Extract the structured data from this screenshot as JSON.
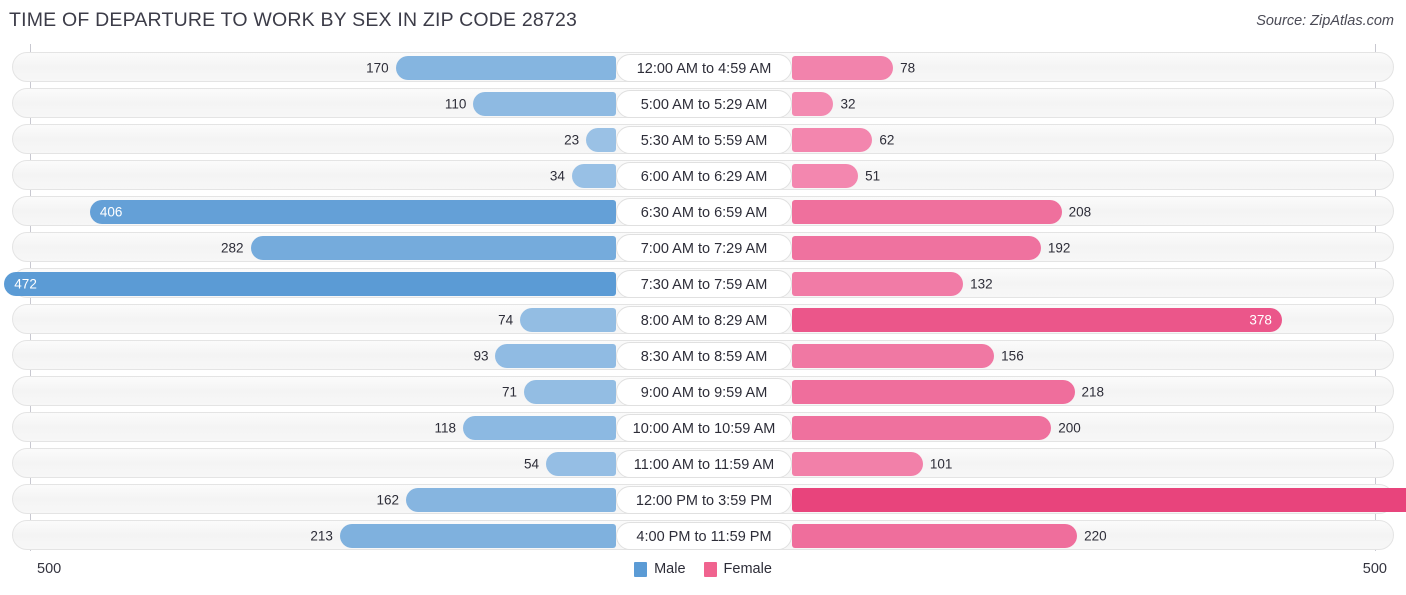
{
  "header": {
    "title": "TIME OF DEPARTURE TO WORK BY SEX IN ZIP CODE 28723",
    "source": "Source: ZipAtlas.com"
  },
  "axis": {
    "max_left_label": "500",
    "max_right_label": "500"
  },
  "legend": {
    "items": [
      {
        "label": "Male",
        "color": "#5b9bd5"
      },
      {
        "label": "Female",
        "color": "#f0638f"
      }
    ]
  },
  "colors": {
    "male_strong": "#5b9bd5",
    "male_light": "#9dc3e6",
    "female_strong": "#e8447c",
    "female_light": "#f48fb5",
    "track": "#f5f5f5",
    "axis": "#c8c8d0",
    "title": "#3c3c48"
  },
  "chart_data": {
    "type": "bar",
    "subtype": "diverging-bidirectional",
    "title": "TIME OF DEPARTURE TO WORK BY SEX IN ZIP CODE 28723",
    "xlabel": "",
    "ylabel": "",
    "xlim": [
      500,
      500
    ],
    "axis_max": 500,
    "grid": false,
    "legend_position": "bottom-center",
    "categories": [
      "12:00 AM to 4:59 AM",
      "5:00 AM to 5:29 AM",
      "5:30 AM to 5:59 AM",
      "6:00 AM to 6:29 AM",
      "6:30 AM to 6:59 AM",
      "7:00 AM to 7:29 AM",
      "7:30 AM to 7:59 AM",
      "8:00 AM to 8:29 AM",
      "8:30 AM to 8:59 AM",
      "9:00 AM to 9:59 AM",
      "10:00 AM to 10:59 AM",
      "11:00 AM to 11:59 AM",
      "12:00 PM to 3:59 PM",
      "4:00 PM to 11:59 PM"
    ],
    "series": [
      {
        "name": "Male",
        "direction": "left",
        "values": [
          170,
          110,
          23,
          34,
          406,
          282,
          472,
          74,
          93,
          71,
          118,
          54,
          162,
          213
        ]
      },
      {
        "name": "Female",
        "direction": "right",
        "values": [
          78,
          32,
          62,
          51,
          208,
          192,
          132,
          378,
          156,
          218,
          200,
          101,
          499,
          220
        ]
      }
    ]
  },
  "rows": [
    {
      "label": "12:00 AM to 4:59 AM",
      "male": "170",
      "female": "78"
    },
    {
      "label": "5:00 AM to 5:29 AM",
      "male": "110",
      "female": "32"
    },
    {
      "label": "5:30 AM to 5:59 AM",
      "male": "23",
      "female": "62"
    },
    {
      "label": "6:00 AM to 6:29 AM",
      "male": "34",
      "female": "51"
    },
    {
      "label": "6:30 AM to 6:59 AM",
      "male": "406",
      "female": "208"
    },
    {
      "label": "7:00 AM to 7:29 AM",
      "male": "282",
      "female": "192"
    },
    {
      "label": "7:30 AM to 7:59 AM",
      "male": "472",
      "female": "132"
    },
    {
      "label": "8:00 AM to 8:29 AM",
      "male": "74",
      "female": "378"
    },
    {
      "label": "8:30 AM to 8:59 AM",
      "male": "93",
      "female": "156"
    },
    {
      "label": "9:00 AM to 9:59 AM",
      "male": "71",
      "female": "218"
    },
    {
      "label": "10:00 AM to 10:59 AM",
      "male": "118",
      "female": "200"
    },
    {
      "label": "11:00 AM to 11:59 AM",
      "male": "54",
      "female": "101"
    },
    {
      "label": "12:00 PM to 3:59 PM",
      "male": "162",
      "female": "499"
    },
    {
      "label": "4:00 PM to 11:59 PM",
      "male": "213",
      "female": "220"
    }
  ]
}
